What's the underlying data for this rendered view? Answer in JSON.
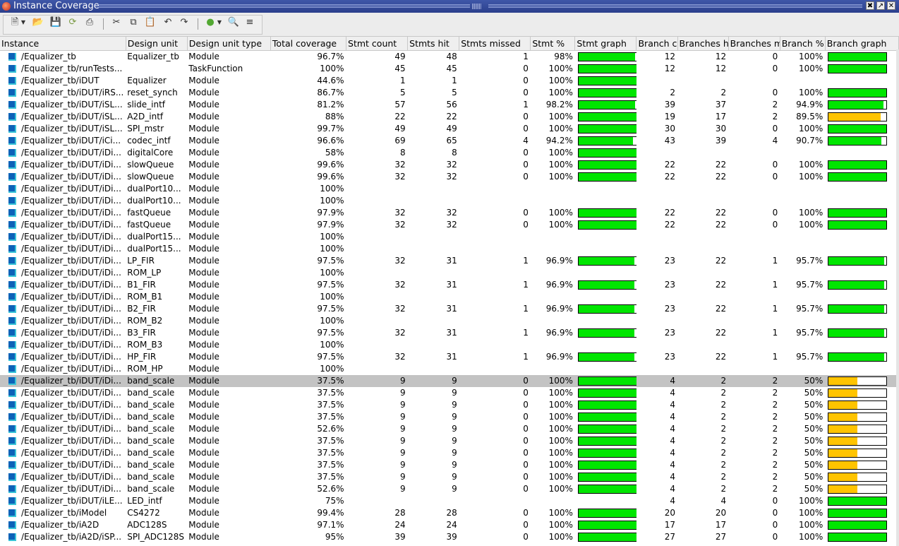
{
  "window": {
    "title": "Instance Coverage",
    "buttons": [
      "✖",
      "↗",
      "✕"
    ]
  },
  "toolbar": {
    "icons": [
      "new-file-icon",
      "dropdown-arrow-icon",
      "open-folder-icon",
      "save-icon",
      "reload-icon",
      "print-icon",
      "cut-icon",
      "copy-icon",
      "paste-icon",
      "undo-icon",
      "redo-icon",
      "filter-icon",
      "dropdown-arrow-icon",
      "find-icon",
      "sort-icon"
    ]
  },
  "columns": [
    "Instance",
    "Design unit",
    "Design unit type",
    "Total coverage",
    "Stmt count",
    "Stmts hit",
    "Stmts missed",
    "Stmt %",
    "Stmt graph",
    "Branch c",
    "Branches h",
    "Branches m",
    "Branch %",
    "Branch graph"
  ],
  "colors": {
    "good": "#00e600",
    "warn": "#ffc400",
    "selected": "#c3c3c3"
  },
  "rows": [
    {
      "instance": "/Equalizer_tb",
      "unit": "Equalizer_tb",
      "type": "Module",
      "total": "96.7%",
      "sc": "49",
      "sh": "48",
      "sm": "1",
      "sp": "98%",
      "sg": 98,
      "sgc": "good",
      "bc": "12",
      "bh": "12",
      "bm": "0",
      "bp": "100%",
      "bg": 100,
      "bgc": "good"
    },
    {
      "instance": "/Equalizer_tb/runTests...",
      "unit": "",
      "type": "TaskFunction",
      "total": "100%",
      "sc": "45",
      "sh": "45",
      "sm": "0",
      "sp": "100%",
      "sg": 100,
      "sgc": "good",
      "bc": "12",
      "bh": "12",
      "bm": "0",
      "bp": "100%",
      "bg": 100,
      "bgc": "good"
    },
    {
      "instance": "/Equalizer_tb/iDUT",
      "unit": "Equalizer",
      "type": "Module",
      "total": "44.6%",
      "sc": "1",
      "sh": "1",
      "sm": "0",
      "sp": "100%",
      "sg": 100,
      "sgc": "good",
      "bc": "",
      "bh": "",
      "bm": "",
      "bp": "",
      "bg": null,
      "bgc": ""
    },
    {
      "instance": "/Equalizer_tb/iDUT/iRS...",
      "unit": "reset_synch",
      "type": "Module",
      "total": "86.7%",
      "sc": "5",
      "sh": "5",
      "sm": "0",
      "sp": "100%",
      "sg": 100,
      "sgc": "good",
      "bc": "2",
      "bh": "2",
      "bm": "0",
      "bp": "100%",
      "bg": 100,
      "bgc": "good"
    },
    {
      "instance": "/Equalizer_tb/iDUT/iSL...",
      "unit": "slide_intf",
      "type": "Module",
      "total": "81.2%",
      "sc": "57",
      "sh": "56",
      "sm": "1",
      "sp": "98.2%",
      "sg": 98.2,
      "sgc": "good",
      "bc": "39",
      "bh": "37",
      "bm": "2",
      "bp": "94.9%",
      "bg": 94.9,
      "bgc": "good"
    },
    {
      "instance": "/Equalizer_tb/iDUT/iSL...",
      "unit": "A2D_intf",
      "type": "Module",
      "total": "88%",
      "sc": "22",
      "sh": "22",
      "sm": "0",
      "sp": "100%",
      "sg": 100,
      "sgc": "good",
      "bc": "19",
      "bh": "17",
      "bm": "2",
      "bp": "89.5%",
      "bg": 89.5,
      "bgc": "warn"
    },
    {
      "instance": "/Equalizer_tb/iDUT/iSL...",
      "unit": "SPI_mstr",
      "type": "Module",
      "total": "99.7%",
      "sc": "49",
      "sh": "49",
      "sm": "0",
      "sp": "100%",
      "sg": 100,
      "sgc": "good",
      "bc": "30",
      "bh": "30",
      "bm": "0",
      "bp": "100%",
      "bg": 100,
      "bgc": "good"
    },
    {
      "instance": "/Equalizer_tb/iDUT/iCi...",
      "unit": "codec_intf",
      "type": "Module",
      "total": "96.6%",
      "sc": "69",
      "sh": "65",
      "sm": "4",
      "sp": "94.2%",
      "sg": 94.2,
      "sgc": "good",
      "bc": "43",
      "bh": "39",
      "bm": "4",
      "bp": "90.7%",
      "bg": 90.7,
      "bgc": "good"
    },
    {
      "instance": "/Equalizer_tb/iDUT/iDi...",
      "unit": "digitalCore",
      "type": "Module",
      "total": "58%",
      "sc": "8",
      "sh": "8",
      "sm": "0",
      "sp": "100%",
      "sg": 100,
      "sgc": "good",
      "bc": "",
      "bh": "",
      "bm": "",
      "bp": "",
      "bg": null,
      "bgc": ""
    },
    {
      "instance": "/Equalizer_tb/iDUT/iDi...",
      "unit": "slowQueue",
      "type": "Module",
      "total": "99.6%",
      "sc": "32",
      "sh": "32",
      "sm": "0",
      "sp": "100%",
      "sg": 100,
      "sgc": "good",
      "bc": "22",
      "bh": "22",
      "bm": "0",
      "bp": "100%",
      "bg": 100,
      "bgc": "good"
    },
    {
      "instance": "/Equalizer_tb/iDUT/iDi...",
      "unit": "slowQueue",
      "type": "Module",
      "total": "99.6%",
      "sc": "32",
      "sh": "32",
      "sm": "0",
      "sp": "100%",
      "sg": 100,
      "sgc": "good",
      "bc": "22",
      "bh": "22",
      "bm": "0",
      "bp": "100%",
      "bg": 100,
      "bgc": "good"
    },
    {
      "instance": "/Equalizer_tb/iDUT/iDi...",
      "unit": "dualPort10...",
      "type": "Module",
      "total": "100%",
      "sc": "",
      "sh": "",
      "sm": "",
      "sp": "",
      "sg": null,
      "sgc": "",
      "bc": "",
      "bh": "",
      "bm": "",
      "bp": "",
      "bg": null,
      "bgc": ""
    },
    {
      "instance": "/Equalizer_tb/iDUT/iDi...",
      "unit": "dualPort10...",
      "type": "Module",
      "total": "100%",
      "sc": "",
      "sh": "",
      "sm": "",
      "sp": "",
      "sg": null,
      "sgc": "",
      "bc": "",
      "bh": "",
      "bm": "",
      "bp": "",
      "bg": null,
      "bgc": ""
    },
    {
      "instance": "/Equalizer_tb/iDUT/iDi...",
      "unit": "fastQueue",
      "type": "Module",
      "total": "97.9%",
      "sc": "32",
      "sh": "32",
      "sm": "0",
      "sp": "100%",
      "sg": 100,
      "sgc": "good",
      "bc": "22",
      "bh": "22",
      "bm": "0",
      "bp": "100%",
      "bg": 100,
      "bgc": "good"
    },
    {
      "instance": "/Equalizer_tb/iDUT/iDi...",
      "unit": "fastQueue",
      "type": "Module",
      "total": "97.9%",
      "sc": "32",
      "sh": "32",
      "sm": "0",
      "sp": "100%",
      "sg": 100,
      "sgc": "good",
      "bc": "22",
      "bh": "22",
      "bm": "0",
      "bp": "100%",
      "bg": 100,
      "bgc": "good"
    },
    {
      "instance": "/Equalizer_tb/iDUT/iDi...",
      "unit": "dualPort15...",
      "type": "Module",
      "total": "100%",
      "sc": "",
      "sh": "",
      "sm": "",
      "sp": "",
      "sg": null,
      "sgc": "",
      "bc": "",
      "bh": "",
      "bm": "",
      "bp": "",
      "bg": null,
      "bgc": ""
    },
    {
      "instance": "/Equalizer_tb/iDUT/iDi...",
      "unit": "dualPort15...",
      "type": "Module",
      "total": "100%",
      "sc": "",
      "sh": "",
      "sm": "",
      "sp": "",
      "sg": null,
      "sgc": "",
      "bc": "",
      "bh": "",
      "bm": "",
      "bp": "",
      "bg": null,
      "bgc": ""
    },
    {
      "instance": "/Equalizer_tb/iDUT/iDi...",
      "unit": "LP_FIR",
      "type": "Module",
      "total": "97.5%",
      "sc": "32",
      "sh": "31",
      "sm": "1",
      "sp": "96.9%",
      "sg": 96.9,
      "sgc": "good",
      "bc": "23",
      "bh": "22",
      "bm": "1",
      "bp": "95.7%",
      "bg": 95.7,
      "bgc": "good"
    },
    {
      "instance": "/Equalizer_tb/iDUT/iDi...",
      "unit": "ROM_LP",
      "type": "Module",
      "total": "100%",
      "sc": "",
      "sh": "",
      "sm": "",
      "sp": "",
      "sg": null,
      "sgc": "",
      "bc": "",
      "bh": "",
      "bm": "",
      "bp": "",
      "bg": null,
      "bgc": ""
    },
    {
      "instance": "/Equalizer_tb/iDUT/iDi...",
      "unit": "B1_FIR",
      "type": "Module",
      "total": "97.5%",
      "sc": "32",
      "sh": "31",
      "sm": "1",
      "sp": "96.9%",
      "sg": 96.9,
      "sgc": "good",
      "bc": "23",
      "bh": "22",
      "bm": "1",
      "bp": "95.7%",
      "bg": 95.7,
      "bgc": "good"
    },
    {
      "instance": "/Equalizer_tb/iDUT/iDi...",
      "unit": "ROM_B1",
      "type": "Module",
      "total": "100%",
      "sc": "",
      "sh": "",
      "sm": "",
      "sp": "",
      "sg": null,
      "sgc": "",
      "bc": "",
      "bh": "",
      "bm": "",
      "bp": "",
      "bg": null,
      "bgc": ""
    },
    {
      "instance": "/Equalizer_tb/iDUT/iDi...",
      "unit": "B2_FIR",
      "type": "Module",
      "total": "97.5%",
      "sc": "32",
      "sh": "31",
      "sm": "1",
      "sp": "96.9%",
      "sg": 96.9,
      "sgc": "good",
      "bc": "23",
      "bh": "22",
      "bm": "1",
      "bp": "95.7%",
      "bg": 95.7,
      "bgc": "good"
    },
    {
      "instance": "/Equalizer_tb/iDUT/iDi...",
      "unit": "ROM_B2",
      "type": "Module",
      "total": "100%",
      "sc": "",
      "sh": "",
      "sm": "",
      "sp": "",
      "sg": null,
      "sgc": "",
      "bc": "",
      "bh": "",
      "bm": "",
      "bp": "",
      "bg": null,
      "bgc": ""
    },
    {
      "instance": "/Equalizer_tb/iDUT/iDi...",
      "unit": "B3_FIR",
      "type": "Module",
      "total": "97.5%",
      "sc": "32",
      "sh": "31",
      "sm": "1",
      "sp": "96.9%",
      "sg": 96.9,
      "sgc": "good",
      "bc": "23",
      "bh": "22",
      "bm": "1",
      "bp": "95.7%",
      "bg": 95.7,
      "bgc": "good"
    },
    {
      "instance": "/Equalizer_tb/iDUT/iDi...",
      "unit": "ROM_B3",
      "type": "Module",
      "total": "100%",
      "sc": "",
      "sh": "",
      "sm": "",
      "sp": "",
      "sg": null,
      "sgc": "",
      "bc": "",
      "bh": "",
      "bm": "",
      "bp": "",
      "bg": null,
      "bgc": ""
    },
    {
      "instance": "/Equalizer_tb/iDUT/iDi...",
      "unit": "HP_FIR",
      "type": "Module",
      "total": "97.5%",
      "sc": "32",
      "sh": "31",
      "sm": "1",
      "sp": "96.9%",
      "sg": 96.9,
      "sgc": "good",
      "bc": "23",
      "bh": "22",
      "bm": "1",
      "bp": "95.7%",
      "bg": 95.7,
      "bgc": "good"
    },
    {
      "instance": "/Equalizer_tb/iDUT/iDi...",
      "unit": "ROM_HP",
      "type": "Module",
      "total": "100%",
      "sc": "",
      "sh": "",
      "sm": "",
      "sp": "",
      "sg": null,
      "sgc": "",
      "bc": "",
      "bh": "",
      "bm": "",
      "bp": "",
      "bg": null,
      "bgc": ""
    },
    {
      "instance": "/Equalizer_tb/iDUT/iDi...",
      "unit": "band_scale",
      "type": "Module",
      "total": "37.5%",
      "sc": "9",
      "sh": "9",
      "sm": "0",
      "sp": "100%",
      "sg": 100,
      "sgc": "good",
      "bc": "4",
      "bh": "2",
      "bm": "2",
      "bp": "50%",
      "bg": 50,
      "bgc": "warn",
      "selected": true
    },
    {
      "instance": "/Equalizer_tb/iDUT/iDi...",
      "unit": "band_scale",
      "type": "Module",
      "total": "37.5%",
      "sc": "9",
      "sh": "9",
      "sm": "0",
      "sp": "100%",
      "sg": 100,
      "sgc": "good",
      "bc": "4",
      "bh": "2",
      "bm": "2",
      "bp": "50%",
      "bg": 50,
      "bgc": "warn"
    },
    {
      "instance": "/Equalizer_tb/iDUT/iDi...",
      "unit": "band_scale",
      "type": "Module",
      "total": "37.5%",
      "sc": "9",
      "sh": "9",
      "sm": "0",
      "sp": "100%",
      "sg": 100,
      "sgc": "good",
      "bc": "4",
      "bh": "2",
      "bm": "2",
      "bp": "50%",
      "bg": 50,
      "bgc": "warn"
    },
    {
      "instance": "/Equalizer_tb/iDUT/iDi...",
      "unit": "band_scale",
      "type": "Module",
      "total": "37.5%",
      "sc": "9",
      "sh": "9",
      "sm": "0",
      "sp": "100%",
      "sg": 100,
      "sgc": "good",
      "bc": "4",
      "bh": "2",
      "bm": "2",
      "bp": "50%",
      "bg": 50,
      "bgc": "warn"
    },
    {
      "instance": "/Equalizer_tb/iDUT/iDi...",
      "unit": "band_scale",
      "type": "Module",
      "total": "52.6%",
      "sc": "9",
      "sh": "9",
      "sm": "0",
      "sp": "100%",
      "sg": 100,
      "sgc": "good",
      "bc": "4",
      "bh": "2",
      "bm": "2",
      "bp": "50%",
      "bg": 50,
      "bgc": "warn"
    },
    {
      "instance": "/Equalizer_tb/iDUT/iDi...",
      "unit": "band_scale",
      "type": "Module",
      "total": "37.5%",
      "sc": "9",
      "sh": "9",
      "sm": "0",
      "sp": "100%",
      "sg": 100,
      "sgc": "good",
      "bc": "4",
      "bh": "2",
      "bm": "2",
      "bp": "50%",
      "bg": 50,
      "bgc": "warn"
    },
    {
      "instance": "/Equalizer_tb/iDUT/iDi...",
      "unit": "band_scale",
      "type": "Module",
      "total": "37.5%",
      "sc": "9",
      "sh": "9",
      "sm": "0",
      "sp": "100%",
      "sg": 100,
      "sgc": "good",
      "bc": "4",
      "bh": "2",
      "bm": "2",
      "bp": "50%",
      "bg": 50,
      "bgc": "warn"
    },
    {
      "instance": "/Equalizer_tb/iDUT/iDi...",
      "unit": "band_scale",
      "type": "Module",
      "total": "37.5%",
      "sc": "9",
      "sh": "9",
      "sm": "0",
      "sp": "100%",
      "sg": 100,
      "sgc": "good",
      "bc": "4",
      "bh": "2",
      "bm": "2",
      "bp": "50%",
      "bg": 50,
      "bgc": "warn"
    },
    {
      "instance": "/Equalizer_tb/iDUT/iDi...",
      "unit": "band_scale",
      "type": "Module",
      "total": "37.5%",
      "sc": "9",
      "sh": "9",
      "sm": "0",
      "sp": "100%",
      "sg": 100,
      "sgc": "good",
      "bc": "4",
      "bh": "2",
      "bm": "2",
      "bp": "50%",
      "bg": 50,
      "bgc": "warn"
    },
    {
      "instance": "/Equalizer_tb/iDUT/iDi...",
      "unit": "band_scale",
      "type": "Module",
      "total": "52.6%",
      "sc": "9",
      "sh": "9",
      "sm": "0",
      "sp": "100%",
      "sg": 100,
      "sgc": "good",
      "bc": "4",
      "bh": "2",
      "bm": "2",
      "bp": "50%",
      "bg": 50,
      "bgc": "warn"
    },
    {
      "instance": "/Equalizer_tb/iDUT/iLE...",
      "unit": "LED_intf",
      "type": "Module",
      "total": "75%",
      "sc": "",
      "sh": "",
      "sm": "",
      "sp": "",
      "sg": null,
      "sgc": "",
      "bc": "4",
      "bh": "4",
      "bm": "0",
      "bp": "100%",
      "bg": 100,
      "bgc": "good"
    },
    {
      "instance": "/Equalizer_tb/iModel",
      "unit": "CS4272",
      "type": "Module",
      "total": "99.4%",
      "sc": "28",
      "sh": "28",
      "sm": "0",
      "sp": "100%",
      "sg": 100,
      "sgc": "good",
      "bc": "20",
      "bh": "20",
      "bm": "0",
      "bp": "100%",
      "bg": 100,
      "bgc": "good"
    },
    {
      "instance": "/Equalizer_tb/iA2D",
      "unit": "ADC128S",
      "type": "Module",
      "total": "97.1%",
      "sc": "24",
      "sh": "24",
      "sm": "0",
      "sp": "100%",
      "sg": 100,
      "sgc": "good",
      "bc": "17",
      "bh": "17",
      "bm": "0",
      "bp": "100%",
      "bg": 100,
      "bgc": "good"
    },
    {
      "instance": "/Equalizer_tb/iA2D/iSP...",
      "unit": "SPI_ADC128S",
      "type": "Module",
      "total": "95%",
      "sc": "39",
      "sh": "39",
      "sm": "0",
      "sp": "100%",
      "sg": 100,
      "sgc": "good",
      "bc": "27",
      "bh": "27",
      "bm": "0",
      "bp": "100%",
      "bg": 100,
      "bgc": "good"
    }
  ]
}
